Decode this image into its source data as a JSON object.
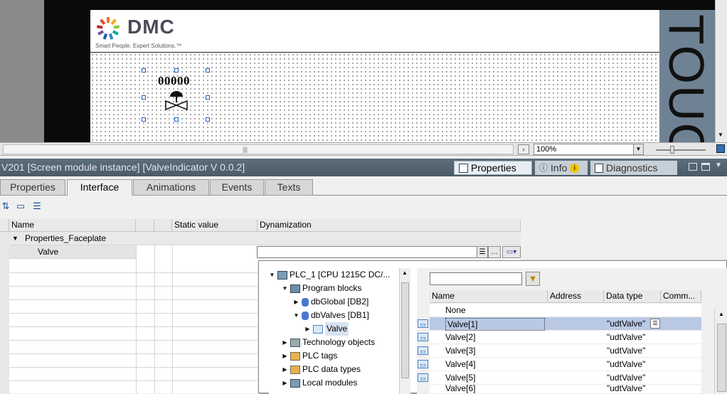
{
  "editor": {
    "logo": {
      "brand": "DMC",
      "tagline": "Smart People. Expert Solutions.™"
    },
    "side_label": "TOUCH",
    "screen_module": {
      "counter": "00000"
    },
    "zoom": "100%"
  },
  "inspector": {
    "title": "V201 [Screen module instance] [ValveIndicator V 0.0.2]",
    "tabs": [
      {
        "label": "Properties",
        "icon": "properties-icon"
      },
      {
        "label": "Info",
        "icon": "info-icon"
      },
      {
        "label": "Diagnostics",
        "icon": "diagnostics-icon"
      }
    ]
  },
  "subtabs": [
    "Properties",
    "Interface",
    "Animations",
    "Events",
    "Texts"
  ],
  "active_subtab": "Interface",
  "grid": {
    "columns": [
      "Name",
      "Static value",
      "Dynamization"
    ],
    "rows": [
      {
        "name": "Properties_Faceplate",
        "expanded": true
      },
      {
        "name": "Valve"
      }
    ]
  },
  "tag_picker": {
    "tree": [
      {
        "label": "PLC_1 [CPU 1215C DC/...",
        "level": 0,
        "expanded": true,
        "icon": "plc-icon"
      },
      {
        "label": "Program blocks",
        "level": 1,
        "expanded": true,
        "icon": "program-blocks-icon"
      },
      {
        "label": "dbGlobal [DB2]",
        "level": 2,
        "expanded": false,
        "icon": "db-icon"
      },
      {
        "label": "dbValves [DB1]",
        "level": 2,
        "expanded": true,
        "icon": "db-icon"
      },
      {
        "label": "Valve",
        "level": 3,
        "expanded": false,
        "icon": "udt-icon",
        "selected": true
      },
      {
        "label": "Technology objects",
        "level": 1,
        "expanded": false,
        "icon": "tech-objects-icon"
      },
      {
        "label": "PLC tags",
        "level": 1,
        "expanded": false,
        "icon": "plc-tags-icon"
      },
      {
        "label": "PLC data types",
        "level": 1,
        "expanded": false,
        "icon": "plc-datatypes-icon"
      },
      {
        "label": "Local modules",
        "level": 1,
        "expanded": false,
        "icon": "local-modules-icon"
      }
    ],
    "filter_placeholder": "",
    "columns": [
      "Name",
      "Address",
      "Data type",
      "Comm..."
    ],
    "rows": [
      {
        "name": "None",
        "address": "",
        "type": ""
      },
      {
        "name": "Valve[1]",
        "address": "",
        "type": "\"udtValve\"",
        "selected": true
      },
      {
        "name": "Valve[2]",
        "address": "",
        "type": "\"udtValve\""
      },
      {
        "name": "Valve[3]",
        "address": "",
        "type": "\"udtValve\""
      },
      {
        "name": "Valve[4]",
        "address": "",
        "type": "\"udtValve\""
      },
      {
        "name": "Valve[5]",
        "address": "",
        "type": "\"udtValve\""
      },
      {
        "name": "Valve[6]",
        "address": "",
        "type": "\"udtValve\""
      }
    ]
  },
  "colors": {
    "accent": "#4b5a67",
    "selection": "#b9c9e4"
  }
}
